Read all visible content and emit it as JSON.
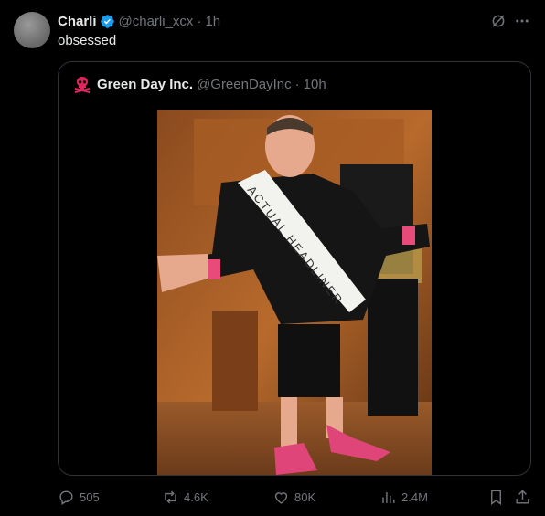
{
  "tweet": {
    "author_name": "Charli",
    "handle": "@charli_xcx",
    "separator": "·",
    "time": "1h",
    "text": "obsessed"
  },
  "quoted": {
    "author_name": "Green Day Inc.",
    "handle": "@GreenDayInc",
    "separator": "·",
    "time": "10h",
    "image_sash_text": "ACTUAL HEADLINER"
  },
  "actions": {
    "replies": "505",
    "reposts": "4.6K",
    "likes": "80K",
    "views": "2.4M"
  },
  "colors": {
    "background": "#000000",
    "text_primary": "#e7e9ea",
    "text_secondary": "#71767b",
    "verified": "#1d9bf0",
    "border": "#2f3336",
    "quoted_avatar": "#e0245e"
  }
}
